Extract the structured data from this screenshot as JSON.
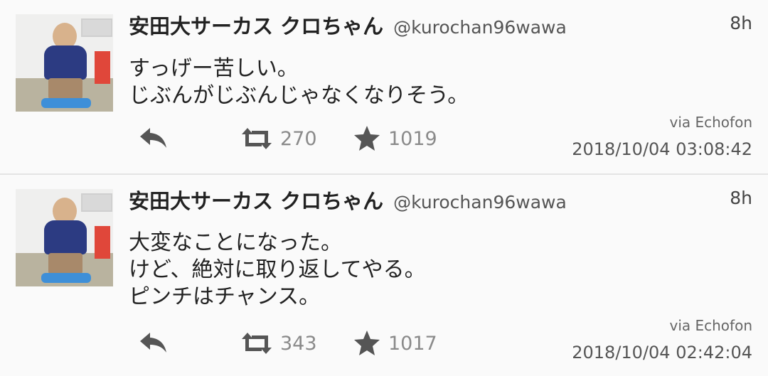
{
  "tweets": [
    {
      "author_name": "安田大サーカス クロちゃん",
      "author_handle": "@kurochan96wawa",
      "age": "8h",
      "text": "すっげー苦しい。\nじぶんがじぶんじゃなくなりそう。",
      "retweet_count": "270",
      "favorite_count": "1019",
      "via": "via Echofon",
      "timestamp": "2018/10/04 03:08:42"
    },
    {
      "author_name": "安田大サーカス クロちゃん",
      "author_handle": "@kurochan96wawa",
      "age": "8h",
      "text": "大変なことになった。\nけど、絶対に取り返してやる。\nピンチはチャンス。",
      "retweet_count": "343",
      "favorite_count": "1017",
      "via": "via Echofon",
      "timestamp": "2018/10/04 02:42:04"
    }
  ]
}
